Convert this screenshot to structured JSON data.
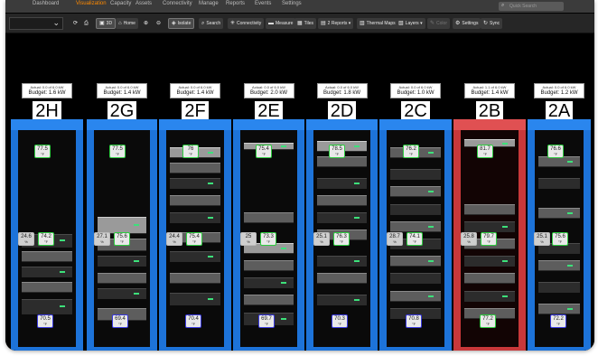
{
  "nav": {
    "items": [
      "Dashboard",
      "Visualization",
      "Capacity",
      "Assets",
      "Connectivity",
      "Manage",
      "Reports",
      "Events",
      "Settings"
    ],
    "active_index": 1,
    "search_placeholder": "Quick Search"
  },
  "toolbar": {
    "buttons": [
      {
        "name": "refresh",
        "label": "",
        "icon": "⟳"
      },
      {
        "name": "print",
        "label": "",
        "icon": "⎙"
      },
      {
        "name": "3d",
        "label": "3D",
        "icon": "▣"
      },
      {
        "name": "home",
        "label": "Home",
        "icon": "⌂"
      },
      {
        "name": "zoom-in",
        "label": "",
        "icon": "⊕"
      },
      {
        "name": "zoom-out",
        "label": "",
        "icon": "⊖"
      },
      {
        "name": "isolate",
        "label": "Isolate",
        "icon": "◈"
      },
      {
        "name": "search",
        "label": "Search",
        "icon": "⌕"
      },
      {
        "name": "connectivity",
        "label": "Connectivity",
        "icon": "✳"
      },
      {
        "name": "measure",
        "label": "Measure",
        "icon": "▬"
      },
      {
        "name": "tiles",
        "label": "Tiles",
        "icon": "▦"
      },
      {
        "name": "reports",
        "label": "2 Reports ▾",
        "icon": "▤"
      },
      {
        "name": "thermal-maps",
        "label": "Thermal Maps",
        "icon": "▥"
      },
      {
        "name": "layers",
        "label": "Layers ▾",
        "icon": "▧"
      },
      {
        "name": "color",
        "label": "Color",
        "icon": "✎"
      },
      {
        "name": "settings",
        "label": "Settings",
        "icon": "⚙"
      },
      {
        "name": "sync",
        "label": "Sync",
        "icon": "↻"
      }
    ]
  },
  "colors": {
    "rack_blue": "#1d73d9",
    "rack_red": "#c8383a",
    "sensor_green": "#2ecc40",
    "sensor_blue": "#3a3ae0"
  },
  "racks": [
    {
      "id": "2H",
      "actual": "Actual: 0.0 of 6.0 kW",
      "budget": "Budget: 1.6 kW",
      "status": "normal",
      "top": "77.5",
      "hum": "24.6",
      "mid": "74.2",
      "bot": "70.5"
    },
    {
      "id": "2G",
      "actual": "Actual: 0.0 of 6.0 kW",
      "budget": "Budget: 1.4 kW",
      "status": "normal",
      "top": "77.5",
      "hum": "27.1",
      "mid": "75.6",
      "bot": "69.4"
    },
    {
      "id": "2F",
      "actual": "Actual: 0.0 of 6.0 kW",
      "budget": "Budget: 1.4 kW",
      "status": "normal",
      "top": "76",
      "hum": "24.4",
      "mid": "75.4",
      "bot": "70.4"
    },
    {
      "id": "2E",
      "actual": "Actual: 0.0 of 6.0 kW",
      "budget": "Budget: 2.0 kW",
      "status": "normal",
      "top": "75.4",
      "hum": "25",
      "mid": "73.3",
      "bot": "69.7"
    },
    {
      "id": "2D",
      "actual": "Actual: 0.0 of 6.0 kW",
      "budget": "Budget: 1.8 kW",
      "status": "normal",
      "top": "78.5",
      "hum": "25.1",
      "mid": "76.3",
      "bot": "70.3"
    },
    {
      "id": "2C",
      "actual": "Actual: 0.0 of 6.0 kW",
      "budget": "Budget: 1.0 kW",
      "status": "normal",
      "top": "76.2",
      "hum": "28.7",
      "mid": "74.1",
      "bot": "70.8"
    },
    {
      "id": "2B",
      "actual": "Actual: 1.1 of 6.0 kW",
      "budget": "Budget: 1.4 kW",
      "status": "alert",
      "top": "81.7",
      "hum": "25.8",
      "mid": "79.7",
      "bot": "77.2"
    },
    {
      "id": "2A",
      "actual": "Actual: 0.0 of 6.0 kW",
      "budget": "Budget: 1.2 kW",
      "status": "normal",
      "top": "76.6",
      "hum": "25.1",
      "mid": "75.6",
      "bot": "72.2"
    }
  ],
  "units": {
    "temp": "°F",
    "hum": "%"
  }
}
